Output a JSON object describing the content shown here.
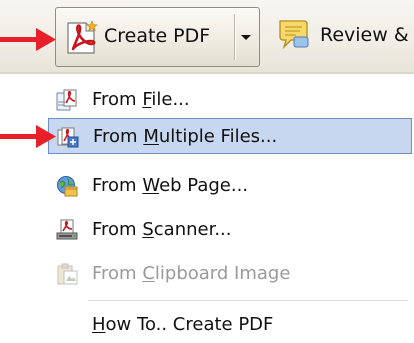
{
  "toolbar": {
    "create_pdf": {
      "label": "Create PDF",
      "icon": "create-pdf-icon",
      "dropdown_icon": "chevron-down-icon"
    },
    "review": {
      "label": "Review &",
      "icon": "comment-icon"
    }
  },
  "menu": {
    "items": [
      {
        "before": "From ",
        "accel": "F",
        "after": "ile...",
        "icon": "pdf-from-file-icon",
        "highlighted": false,
        "enabled": true
      },
      {
        "before": "From ",
        "accel": "M",
        "after": "ultiple Files...",
        "icon": "pdf-multiple-files-icon",
        "highlighted": true,
        "enabled": true
      },
      {
        "before": "From ",
        "accel": "W",
        "after": "eb Page...",
        "icon": "web-page-icon",
        "highlighted": false,
        "enabled": true
      },
      {
        "before": "From ",
        "accel": "S",
        "after": "canner...",
        "icon": "scanner-icon",
        "highlighted": false,
        "enabled": true
      },
      {
        "before": "From ",
        "accel": "C",
        "after": "lipboard Image",
        "icon": "clipboard-image-icon",
        "highlighted": false,
        "enabled": false
      }
    ],
    "help": {
      "accel": "H",
      "after": "ow To.. Create PDF"
    }
  },
  "colors": {
    "annotation_arrow": "#e8202a",
    "highlight_fill": "#c6d7ef",
    "highlight_border": "#6b8fbf",
    "disabled_text": "#9a9a9a",
    "pdf_red": "#c8141e"
  }
}
